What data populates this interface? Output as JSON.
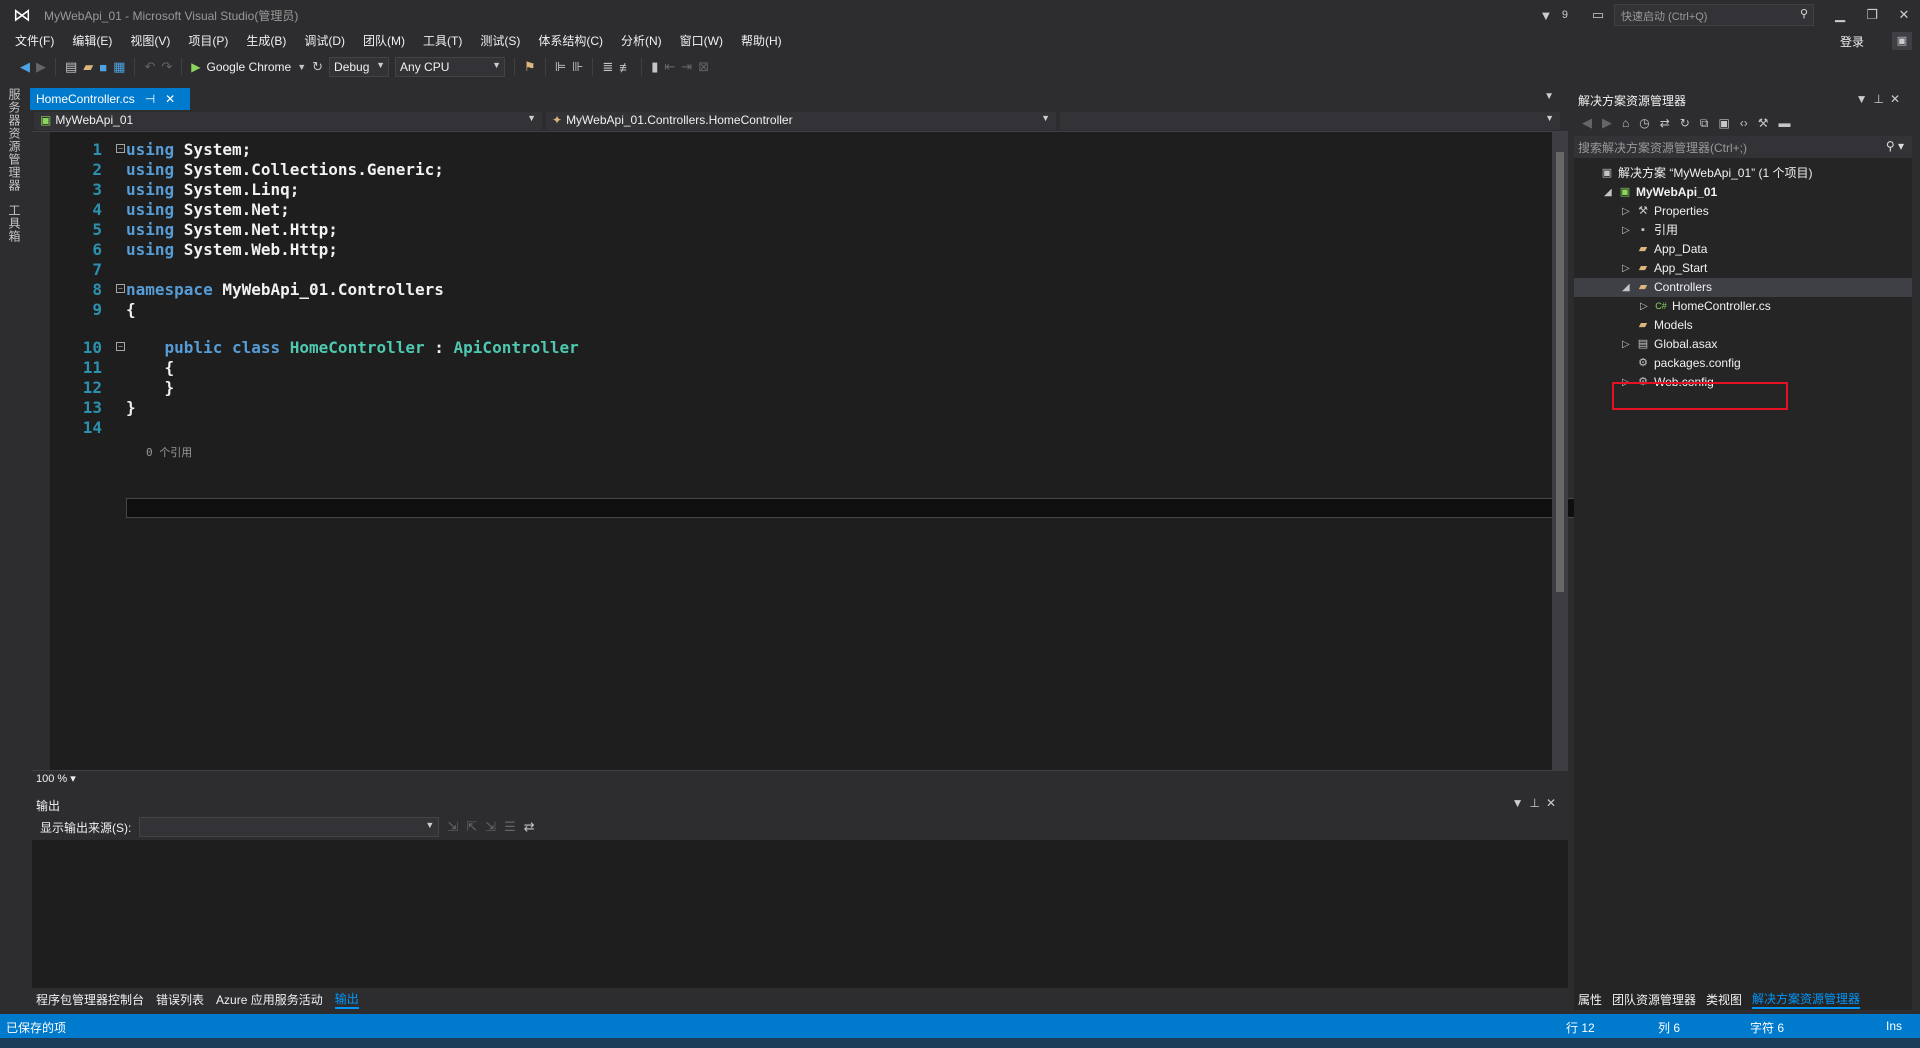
{
  "titlebar": {
    "title": "MyWebApi_01 - Microsoft Visual Studio(管理员)",
    "notifications": "9",
    "quick_launch_placeholder": "快速启动 (Ctrl+Q)",
    "login": "登录"
  },
  "menu": [
    "文件(F)",
    "编辑(E)",
    "视图(V)",
    "项目(P)",
    "生成(B)",
    "调试(D)",
    "团队(M)",
    "工具(T)",
    "测试(S)",
    "体系结构(C)",
    "分析(N)",
    "窗口(W)",
    "帮助(H)"
  ],
  "toolbar": {
    "run_target": "Google Chrome",
    "configuration": "Debug",
    "platform": "Any CPU"
  },
  "left_rail": [
    "服务器资源管理器",
    "工具箱"
  ],
  "editor": {
    "tab_label": "HomeController.cs",
    "nav_project": "MyWebApi_01",
    "nav_class": "MyWebApi_01.Controllers.HomeController",
    "zoom": "100 %",
    "codelens": "0 个引用",
    "lines": [
      {
        "n": "1",
        "parts": [
          [
            "kw",
            "using "
          ],
          [
            "tx",
            "System;"
          ]
        ]
      },
      {
        "n": "2",
        "parts": [
          [
            "kw",
            "using "
          ],
          [
            "tx",
            "System.Collections.Generic;"
          ]
        ]
      },
      {
        "n": "3",
        "parts": [
          [
            "kw",
            "using "
          ],
          [
            "tx",
            "System.Linq;"
          ]
        ]
      },
      {
        "n": "4",
        "parts": [
          [
            "kw",
            "using "
          ],
          [
            "tx",
            "System.Net;"
          ]
        ]
      },
      {
        "n": "5",
        "parts": [
          [
            "kw",
            "using "
          ],
          [
            "tx",
            "System.Net.Http;"
          ]
        ]
      },
      {
        "n": "6",
        "parts": [
          [
            "kw",
            "using "
          ],
          [
            "tx",
            "System.Web.Http;"
          ]
        ]
      },
      {
        "n": "7",
        "parts": []
      },
      {
        "n": "8",
        "parts": [
          [
            "kw",
            "namespace "
          ],
          [
            "tx",
            "MyWebApi_01.Controllers"
          ]
        ]
      },
      {
        "n": "9",
        "parts": [
          [
            "tx",
            "{"
          ]
        ]
      },
      {
        "n": "10",
        "parts": [
          [
            "tx",
            "    "
          ],
          [
            "kw",
            "public class "
          ],
          [
            "ty",
            "HomeController"
          ],
          [
            "tx",
            " : "
          ],
          [
            "ty",
            "ApiController"
          ]
        ]
      },
      {
        "n": "11",
        "parts": [
          [
            "tx",
            "    {"
          ]
        ]
      },
      {
        "n": "12",
        "parts": [
          [
            "tx",
            "    }"
          ]
        ]
      },
      {
        "n": "13",
        "parts": [
          [
            "tx",
            "}"
          ]
        ]
      },
      {
        "n": "14",
        "parts": []
      }
    ]
  },
  "output": {
    "title": "输出",
    "source_label": "显示输出来源(S):"
  },
  "bottom_tabs": [
    "程序包管理器控制台",
    "错误列表",
    "Azure 应用服务活动",
    "输出"
  ],
  "solution_explorer": {
    "title": "解决方案资源管理器",
    "search_placeholder": "搜索解决方案资源管理器(Ctrl+;)",
    "nodes": [
      {
        "label": "解决方案 “MyWebApi_01” (1 个项目)",
        "depth": 0,
        "expander": "",
        "icon": "solution-icon"
      },
      {
        "label": "MyWebApi_01",
        "depth": 1,
        "expander": "◢",
        "icon": "project-icon",
        "bold": true
      },
      {
        "label": "Properties",
        "depth": 2,
        "expander": "▷",
        "icon": "wrench-icon"
      },
      {
        "label": "引用",
        "depth": 2,
        "expander": "▷",
        "icon": "references-icon"
      },
      {
        "label": "App_Data",
        "depth": 2,
        "expander": "",
        "icon": "folder-icon"
      },
      {
        "label": "App_Start",
        "depth": 2,
        "expander": "▷",
        "icon": "folder-icon"
      },
      {
        "label": "Controllers",
        "depth": 2,
        "expander": "◢",
        "icon": "folder-icon",
        "selected": true
      },
      {
        "label": "HomeController.cs",
        "depth": 3,
        "expander": "▷",
        "icon": "csharp-file-icon"
      },
      {
        "label": "Models",
        "depth": 2,
        "expander": "",
        "icon": "folder-icon"
      },
      {
        "label": "Global.asax",
        "depth": 2,
        "expander": "▷",
        "icon": "file-icon"
      },
      {
        "label": "packages.config",
        "depth": 2,
        "expander": "",
        "icon": "config-file-icon"
      },
      {
        "label": "Web.config",
        "depth": 2,
        "expander": "▷",
        "icon": "config-file-icon"
      }
    ],
    "bottom_tabs": [
      "属性",
      "团队资源管理器",
      "类视图",
      "解决方案资源管理器"
    ]
  },
  "statusbar": {
    "message": "已保存的项",
    "row": "行 12",
    "col": "列 6",
    "char": "字符 6",
    "mode": "Ins"
  }
}
